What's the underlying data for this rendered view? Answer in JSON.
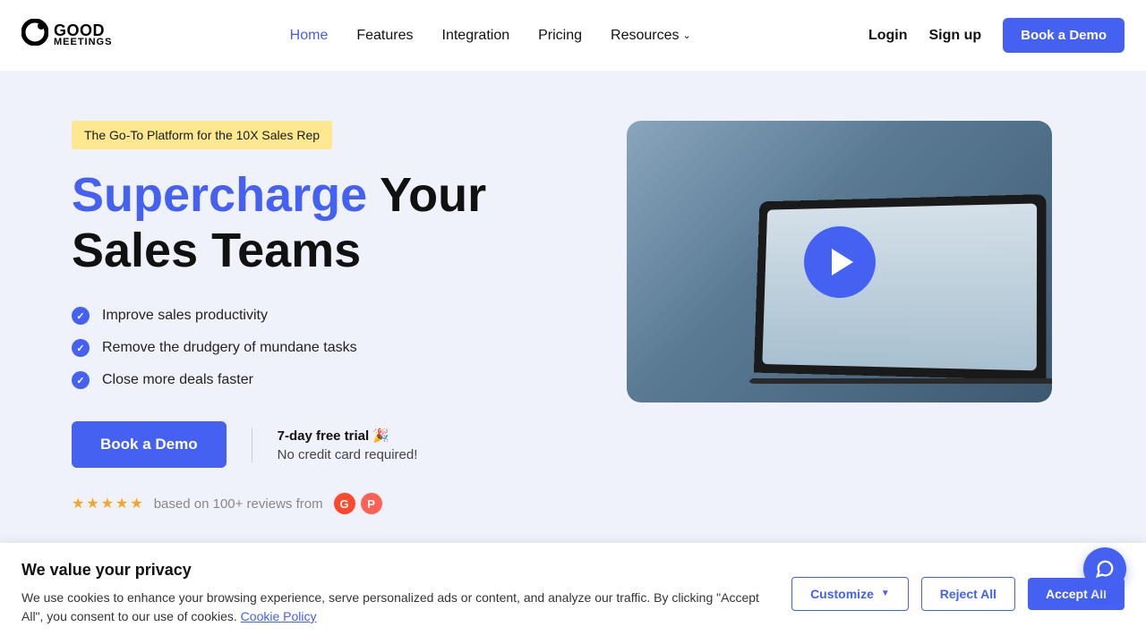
{
  "logo": {
    "good": "GOOD",
    "meetings": "MEETINGS"
  },
  "nav": {
    "home": "Home",
    "features": "Features",
    "integration": "Integration",
    "pricing": "Pricing",
    "resources": "Resources"
  },
  "auth": {
    "login": "Login",
    "signup": "Sign up"
  },
  "header_cta": "Book a Demo",
  "hero": {
    "badge": "The Go-To Platform for the 10X Sales Rep",
    "title_highlight": "Supercharge",
    "title_rest": "Your Sales Teams",
    "features": [
      "Improve sales productivity",
      "Remove the drudgery of mundane tasks",
      "Close more deals faster"
    ],
    "cta": "Book a Demo",
    "trial_title": "7-day free trial 🎉",
    "trial_sub": "No credit card required!",
    "reviews_text": "based on 100+ reviews from"
  },
  "cookie": {
    "title": "We value your privacy",
    "desc_part1": "We use cookies to enhance your browsing experience, serve personalized ads or content, and analyze our traffic. By clicking \"Accept All\", you consent to our use of cookies. ",
    "link": "Cookie Policy",
    "customize": "Customize",
    "reject": "Reject All",
    "accept": "Accept All"
  }
}
